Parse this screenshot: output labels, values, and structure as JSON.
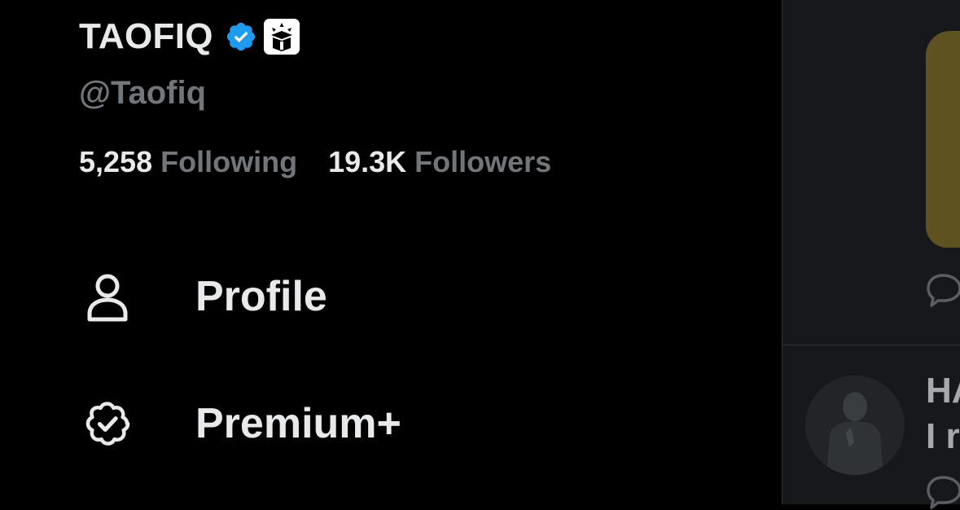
{
  "profile": {
    "display_name": "TAOFIQ",
    "handle": "@Taofiq",
    "following_count": "5,258",
    "following_label": "Following",
    "followers_count": "19.3K",
    "followers_label": "Followers",
    "verified_color": "#1d9bf0"
  },
  "nav": {
    "profile": {
      "label": "Profile",
      "icon": "person-icon"
    },
    "premium": {
      "label": "Premium+",
      "icon": "verified-badge-icon"
    }
  },
  "timeline_peek": {
    "author_fragment": "HA",
    "text_fragment": "I re"
  },
  "colors": {
    "background": "#000000",
    "primary_text": "#e7e9ea",
    "secondary_text": "#71767b",
    "side_panel": "#16181c"
  }
}
